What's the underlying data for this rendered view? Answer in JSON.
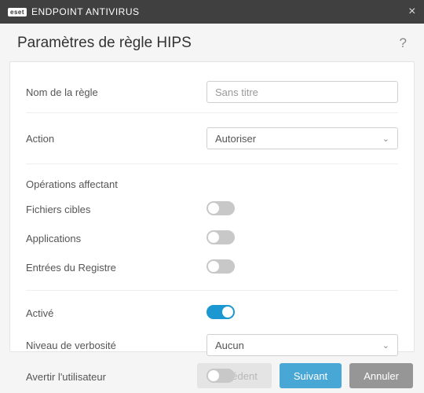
{
  "window": {
    "brand_badge": "eset",
    "app_name": "ENDPOINT ANTIVIRUS"
  },
  "header": {
    "title": "Paramètres de règle HIPS",
    "help_symbol": "?"
  },
  "fields": {
    "name_label": "Nom de la règle",
    "name_placeholder": "Sans titre",
    "name_value": "",
    "action_label": "Action",
    "action_value": "Autoriser",
    "operations_section": "Opérations affectant",
    "target_files_label": "Fichiers cibles",
    "applications_label": "Applications",
    "registry_label": "Entrées du Registre",
    "enabled_label": "Activé",
    "verbosity_label": "Niveau de verbosité",
    "verbosity_value": "Aucun",
    "notify_label": "Avertir l'utilisateur"
  },
  "toggles": {
    "target_files": false,
    "applications": false,
    "registry": false,
    "enabled": true,
    "notify": false
  },
  "footer": {
    "prev": "Précédent",
    "next": "Suivant",
    "cancel": "Annuler"
  }
}
